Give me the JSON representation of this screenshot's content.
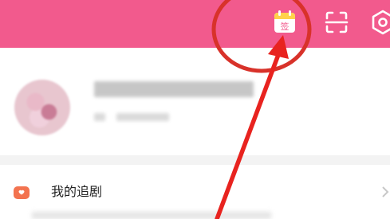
{
  "header": {
    "background_color": "#f25a8d",
    "checkin_icon_glyph": "签",
    "icons": [
      "checkin-calendar-icon",
      "scan-icon",
      "settings-icon"
    ]
  },
  "menu": {
    "items": [
      {
        "label": "我的追剧",
        "icon": "tv-icon",
        "icon_color": "#f3734f"
      }
    ]
  },
  "annotation": {
    "color": "#e8231f",
    "shapes": [
      "circle-highlight",
      "arrow"
    ]
  }
}
